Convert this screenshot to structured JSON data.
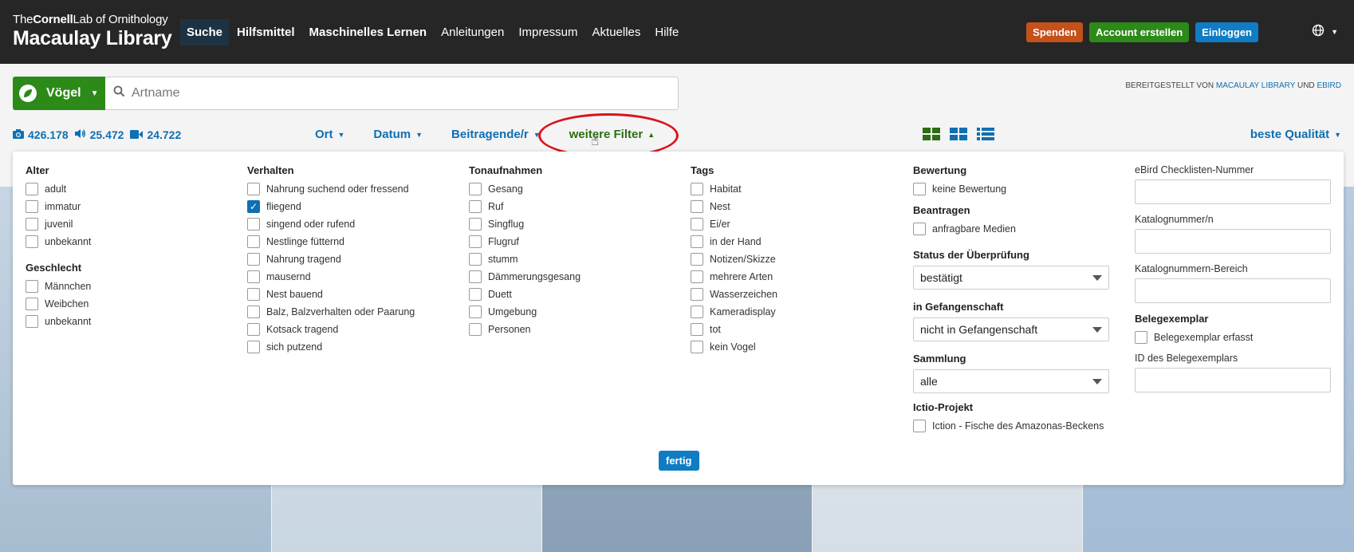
{
  "header": {
    "logo_line1_prefix": "The",
    "logo_line1_bold": "Cornell",
    "logo_line1_mid": "Lab",
    "logo_line1_suffix": "of Ornithology",
    "logo_title": "Macaulay Library",
    "nav": [
      "Suche",
      "Hilfsmittel",
      "Maschinelles Lernen",
      "Anleitungen",
      "Impressum",
      "Aktuelles",
      "Hilfe"
    ],
    "buttons": {
      "donate": "Spenden",
      "create": "Account erstellen",
      "login": "Einloggen"
    }
  },
  "search": {
    "taxon_label": "Vögel",
    "placeholder": "Artname",
    "credit_prefix": "Bereitgestellt von",
    "credit_link1": "Macaulay Library",
    "credit_and": "und",
    "credit_link2": "eBird"
  },
  "counts": {
    "photos": "426.178",
    "audio": "25.472",
    "video": "24.722"
  },
  "filters": {
    "place": "Ort",
    "date": "Datum",
    "contributor": "Beitragende/r",
    "more": "weitere Filter"
  },
  "sort": "beste Qualität",
  "panel": {
    "col1": {
      "age_title": "Alter",
      "age": [
        "adult",
        "immatur",
        "juvenil",
        "unbekannt"
      ],
      "sex_title": "Geschlecht",
      "sex": [
        "Männchen",
        "Weibchen",
        "unbekannt"
      ]
    },
    "col2": {
      "title": "Verhalten",
      "items": [
        "Nahrung suchend oder fressend",
        "fliegend",
        "singend oder rufend",
        "Nestlinge fütternd",
        "Nahrung tragend",
        "mausernd",
        "Nest bauend",
        "Balz, Balzverhalten oder Paarung",
        "Kotsack tragend",
        "sich putzend"
      ],
      "checked": [
        false,
        true,
        false,
        false,
        false,
        false,
        false,
        false,
        false,
        false
      ]
    },
    "col3": {
      "title": "Tonaufnahmen",
      "items": [
        "Gesang",
        "Ruf",
        "Singflug",
        "Flugruf",
        "stumm",
        "Dämmerungsgesang",
        "Duett",
        "Umgebung",
        "Personen"
      ]
    },
    "col4": {
      "title": "Tags",
      "items": [
        "Habitat",
        "Nest",
        "Ei/er",
        "in der Hand",
        "Notizen/Skizze",
        "mehrere Arten",
        "Wasserzeichen",
        "Kameradisplay",
        "tot",
        "kein Vogel"
      ]
    },
    "col5": {
      "rating_title": "Bewertung",
      "rating_item": "keine Bewertung",
      "request_title": "Beantragen",
      "request_item": "anfragbare Medien",
      "review_title": "Status der Überprüfung",
      "review_value": "bestätigt",
      "captive_title": "in Gefangenschaft",
      "captive_value": "nicht in Gefangenschaft",
      "collection_title": "Sammlung",
      "collection_value": "alle",
      "project_title": "Ictio-Projekt",
      "project_item": "Iction - Fische des Amazonas-Beckens"
    },
    "col6": {
      "checklist_label": "eBird Checklisten-Nummer",
      "catalog_label": "Katalognummer/n",
      "catalog_range_label": "Katalognummern-Bereich",
      "specimen_title": "Belegexemplar",
      "specimen_item": "Belegexemplar erfasst",
      "specimen_id_label": "ID des Belegexemplars"
    },
    "done": "fertig"
  }
}
